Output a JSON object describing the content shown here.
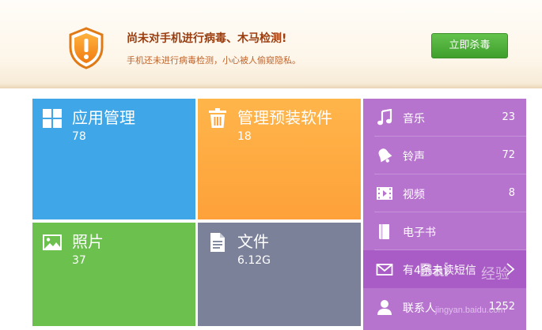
{
  "warning": {
    "title": "尚未对手机进行病毒、木马检测!",
    "subtitle": "手机还未进行病毒检测，小心被人偷窥隐私。",
    "button_label": "立即杀毒",
    "icon": "shield-warning-icon",
    "colors": {
      "title": "#9b3d0e",
      "subtitle": "#c0642c",
      "button": "#4cad35"
    }
  },
  "tiles": {
    "apps": {
      "label": "应用管理",
      "count": "78",
      "icon": "grid-icon",
      "color": "#3fa6e8"
    },
    "preinstall": {
      "label": "管理预装软件",
      "count": "18",
      "icon": "trash-icon",
      "color": "#fea13a"
    },
    "photos": {
      "label": "照片",
      "count": "37",
      "icon": "image-icon",
      "color": "#6cc04e"
    },
    "files": {
      "label": "文件",
      "count": "6.12G",
      "icon": "document-icon",
      "color": "#7a8199"
    }
  },
  "media": {
    "color": "#b774cf",
    "items": [
      {
        "label": "音乐",
        "count": "23",
        "icon": "music-note-icon"
      },
      {
        "label": "铃声",
        "count": "72",
        "icon": "bell-icon"
      },
      {
        "label": "视频",
        "count": "8",
        "icon": "film-icon"
      },
      {
        "label": "电子书",
        "count": "",
        "icon": "book-icon"
      },
      {
        "label": "有4条未读短信",
        "count": "",
        "icon": "envelope-icon"
      },
      {
        "label": "联系人",
        "count": "1252",
        "icon": "person-icon"
      }
    ]
  },
  "watermark": {
    "logo": "Bai",
    "text": "经验",
    "url": "jingyan.baidu.com"
  }
}
